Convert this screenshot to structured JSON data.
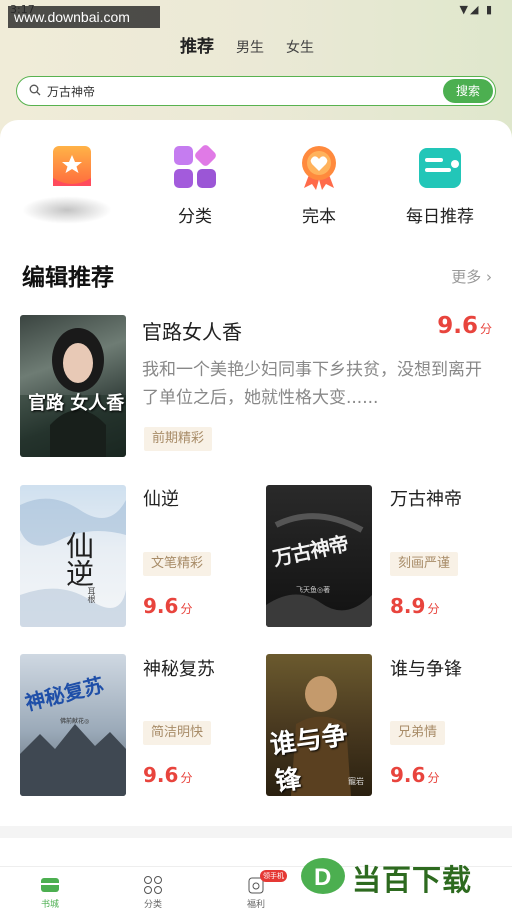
{
  "watermark": "www.downbai.com",
  "status": {
    "time": "3:17",
    "icons": "▼◢ ▮"
  },
  "tabs": [
    {
      "label": "推荐",
      "active": true
    },
    {
      "label": "男生",
      "active": false
    },
    {
      "label": "女生",
      "active": false
    }
  ],
  "search": {
    "value": "万古神帝",
    "button": "搜索"
  },
  "quick": [
    {
      "label": "",
      "icon": "rank-icon"
    },
    {
      "label": "分类",
      "icon": "category-icon"
    },
    {
      "label": "完本",
      "icon": "completed-icon"
    },
    {
      "label": "每日推荐",
      "icon": "daily-icon"
    }
  ],
  "section": {
    "title": "编辑推荐",
    "more": "更多"
  },
  "featured": {
    "title": "官路女人香",
    "score": "9.6",
    "unit": "分",
    "desc": "我和一个美艳少妇同事下乡扶贫，没想到离开了单位之后，她就性格大变......",
    "tag": "前期精彩",
    "cover_text": "官路 女人香"
  },
  "books": [
    {
      "title": "仙逆",
      "tag": "文笔精彩",
      "score": "9.6",
      "unit": "分",
      "cover_text": "仙逆",
      "cover_sub": "耳根"
    },
    {
      "title": "万古神帝",
      "tag": "刻画严谨",
      "score": "8.9",
      "unit": "分",
      "cover_text": "万古神帝",
      "cover_sub": "飞天鱼◎著"
    },
    {
      "title": "神秘复苏",
      "tag": "简洁明快",
      "score": "9.6",
      "unit": "分",
      "cover_text": "神秘复苏",
      "cover_sub": "佛前献花◎"
    },
    {
      "title": "谁与争锋",
      "tag": "兄弟情",
      "score": "9.6",
      "unit": "分",
      "cover_text": "谁与争锋",
      "cover_sub": "寵岩"
    }
  ],
  "nav": [
    {
      "label": "书城",
      "icon": "bookstore-icon",
      "active": true
    },
    {
      "label": "分类",
      "icon": "category-icon",
      "active": false
    },
    {
      "label": "福利",
      "icon": "gift-icon",
      "active": false
    }
  ],
  "badge": "领手机",
  "brand": "当百下载",
  "colors": {
    "accent": "#4caf50",
    "score": "#e8443d",
    "tag_bg": "#f8f1e6"
  }
}
